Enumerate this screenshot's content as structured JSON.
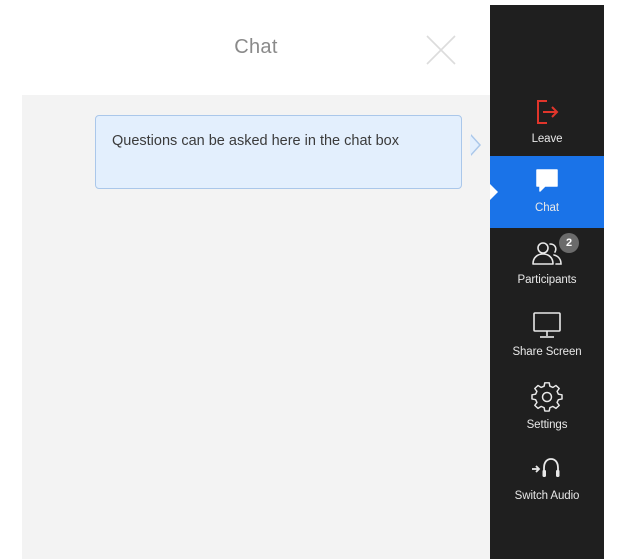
{
  "chat": {
    "title": "Chat",
    "tooltip": "Questions can be asked here in the chat box"
  },
  "sidebar": {
    "items": [
      {
        "label": "Leave",
        "icon": "leave-icon",
        "color": "#e0352b"
      },
      {
        "label": "Chat",
        "icon": "chat-icon",
        "active": true
      },
      {
        "label": "Participants",
        "icon": "participants-icon",
        "badge": "2"
      },
      {
        "label": "Share Screen",
        "icon": "monitor-icon"
      },
      {
        "label": "Settings",
        "icon": "gear-icon"
      },
      {
        "label": "Switch Audio",
        "icon": "headset-icon"
      }
    ]
  },
  "colors": {
    "accent": "#1a73e8",
    "sidebar_bg": "#1f1f1f",
    "leave_red": "#e0352b",
    "tooltip_bg": "#e3effd"
  }
}
